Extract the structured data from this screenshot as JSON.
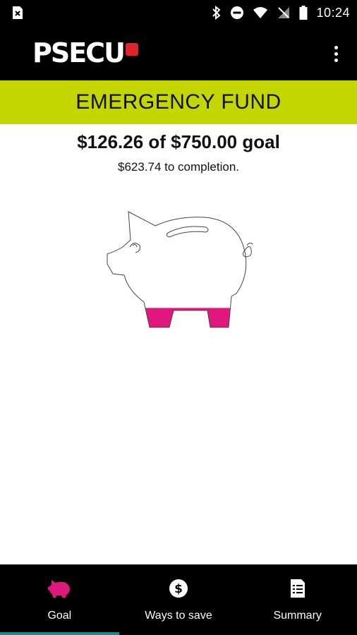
{
  "status_bar": {
    "time": "10:24",
    "icons": [
      "sim-error-icon",
      "bluetooth-icon",
      "do-not-disturb-icon",
      "wifi-icon",
      "no-signal-icon",
      "battery-icon"
    ]
  },
  "app_bar": {
    "logo_text": "PSECU",
    "menu_icon": "more-vert-icon"
  },
  "goal_screen": {
    "title": "EMERGENCY FUND",
    "saved_amount_text": "$126.26 of $750.00 goal",
    "remaining_text": "$623.74 to completion.",
    "saved": 126.26,
    "goal": 750.0,
    "progress_fraction": 0.168,
    "colors": {
      "title_bar": "#c4d600",
      "fill": "#e0177d",
      "brand_red": "#e0232c"
    }
  },
  "bottom_nav": {
    "items": [
      {
        "label": "Goal",
        "icon": "piggy-bank-icon",
        "active": true
      },
      {
        "label": "Ways to save",
        "icon": "dollar-circle-icon",
        "active": false
      },
      {
        "label": "Summary",
        "icon": "document-list-icon",
        "active": false
      }
    ],
    "active_color": "#1f8a8a"
  }
}
